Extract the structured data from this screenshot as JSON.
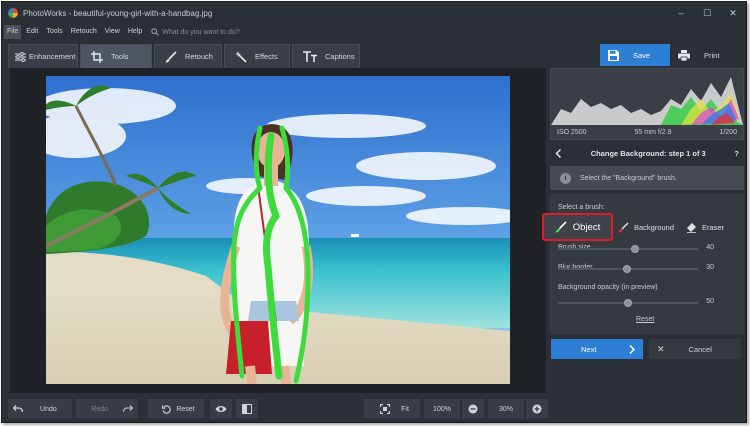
{
  "window": {
    "title": "PhotoWorks - beautiful-young-girl-with-a-handbag.jpg",
    "controls": [
      "–",
      "☐",
      "✕"
    ]
  },
  "menu": {
    "items": [
      "File",
      "Edit",
      "Tools",
      "Retouch",
      "View",
      "Help"
    ],
    "active": "File",
    "search_placeholder": "What do you want to do?"
  },
  "tabs": [
    {
      "label": "Enhancement",
      "icon": "sliders-icon",
      "active": false
    },
    {
      "label": "Tools",
      "icon": "crop-icon",
      "active": true
    },
    {
      "label": "Retouch",
      "icon": "brush-icon",
      "active": false
    },
    {
      "label": "Effects",
      "icon": "magic-wand-icon",
      "active": false
    },
    {
      "label": "Captions",
      "icon": "text-icon",
      "active": false
    }
  ],
  "toolbar": {
    "save_label": "Save",
    "print_label": "Print"
  },
  "histogram": {
    "iso": "ISO 2500",
    "lens": "55 mm f/2.8",
    "shutter": "1/200"
  },
  "panel": {
    "step_title": "Change Background: step 1 of 3",
    "help": "?",
    "hint": "Select the \"Background\" brush.",
    "select_brush_label": "Select a brush:",
    "brushes": [
      {
        "label": "Object",
        "selected": true
      },
      {
        "label": "Background",
        "selected": false
      },
      {
        "label": "Eraser",
        "selected": false
      }
    ],
    "sliders": [
      {
        "label": "Brush size",
        "value": "40",
        "fraction": 0.55
      },
      {
        "label": "Blur border",
        "value": "30",
        "fraction": 0.49
      },
      {
        "label": "Background opacity (in preview)",
        "value": "50",
        "fraction": 0.5
      }
    ],
    "reset_label": "Reset",
    "next_label": "Next",
    "cancel_label": "Cancel"
  },
  "bottom": {
    "undo_label": "Undo",
    "redo_label": "Redo",
    "reset_label": "Reset",
    "fit_label": "Fit",
    "zoom_full": "100%",
    "zoom_current": "30%"
  },
  "colors": {
    "accent": "#2d7fd3",
    "highlight_border": "#e01b23",
    "selection_stroke": "#3ddc3d"
  }
}
